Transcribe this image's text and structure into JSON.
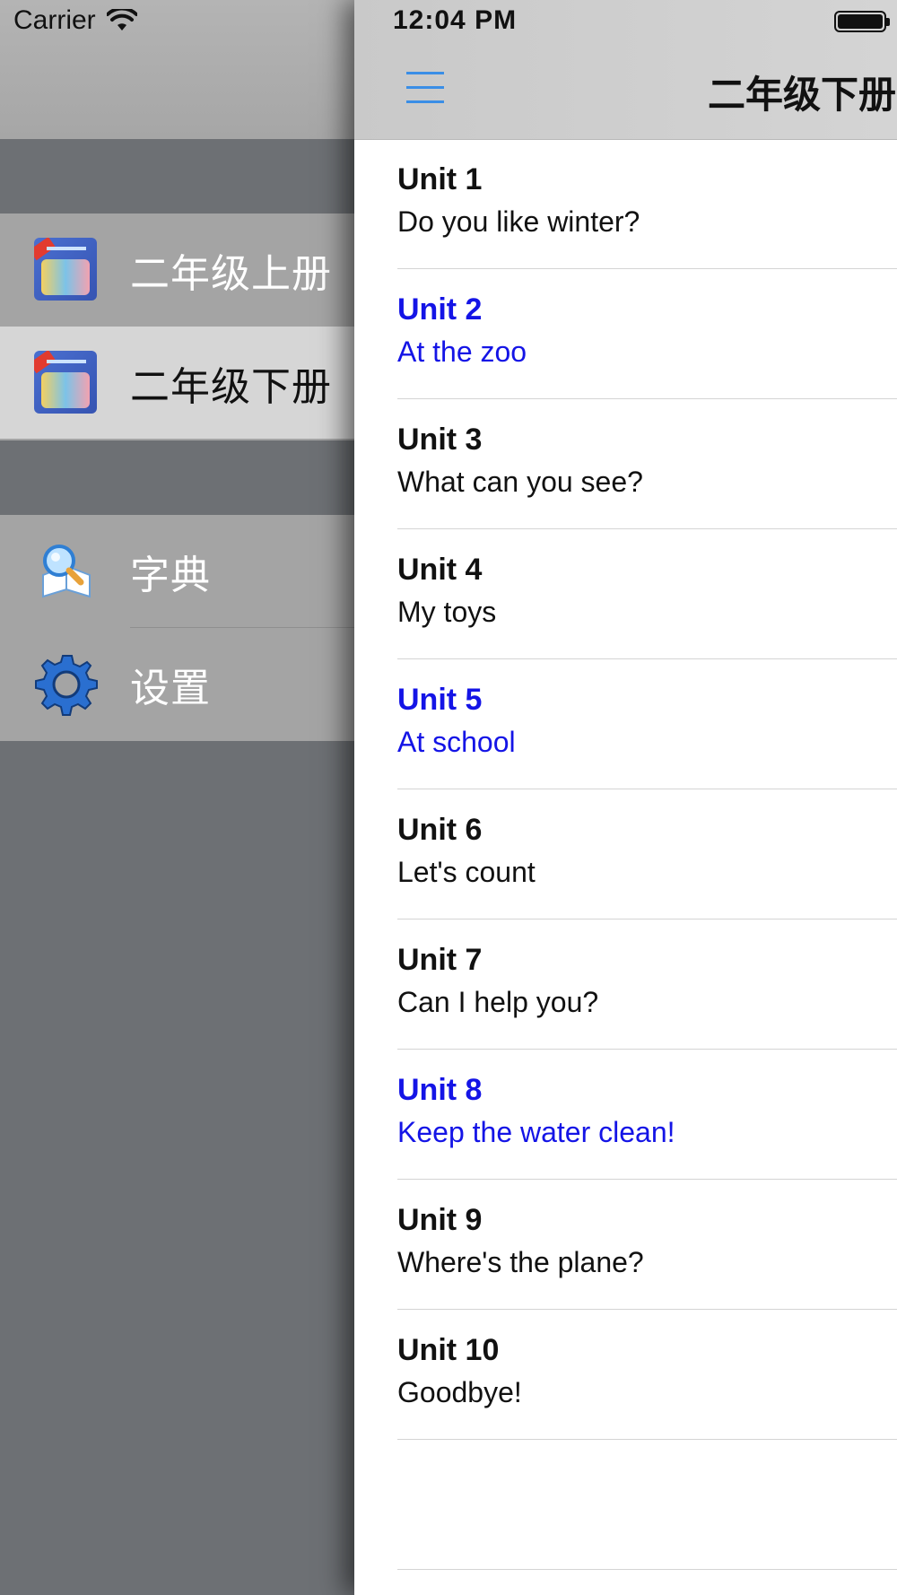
{
  "status": {
    "carrier": "Carrier",
    "time": "12:04 PM"
  },
  "drawer": {
    "books": [
      {
        "label": "二年级上册",
        "selected": false,
        "icon": "book-cover-icon"
      },
      {
        "label": "二年级下册",
        "selected": true,
        "icon": "book-cover-icon"
      }
    ],
    "tools": [
      {
        "label": "字典",
        "icon": "magnifier-book-icon"
      },
      {
        "label": "设置",
        "icon": "gear-icon"
      }
    ]
  },
  "navbar": {
    "title": "二年级下册",
    "menu_icon": "hamburger-icon"
  },
  "units": [
    {
      "unit": "Unit 1",
      "title": "Do you like winter?",
      "highlight": false
    },
    {
      "unit": "Unit 2",
      "title": "At the zoo",
      "highlight": true
    },
    {
      "unit": "Unit 3",
      "title": "What can you see?",
      "highlight": false
    },
    {
      "unit": "Unit 4",
      "title": "My toys",
      "highlight": false
    },
    {
      "unit": "Unit 5",
      "title": "At school",
      "highlight": true
    },
    {
      "unit": "Unit 6",
      "title": "Let's count",
      "highlight": false
    },
    {
      "unit": "Unit 7",
      "title": "Can I help you?",
      "highlight": false
    },
    {
      "unit": "Unit 8",
      "title": "Keep the water clean!",
      "highlight": true
    },
    {
      "unit": "Unit 9",
      "title": "Where's the plane?",
      "highlight": false
    },
    {
      "unit": "Unit 10",
      "title": "Goodbye!",
      "highlight": false
    }
  ],
  "colors": {
    "highlight": "#1414e6",
    "accent": "#3a8ee6",
    "drawer_bg": "#6d7074"
  }
}
